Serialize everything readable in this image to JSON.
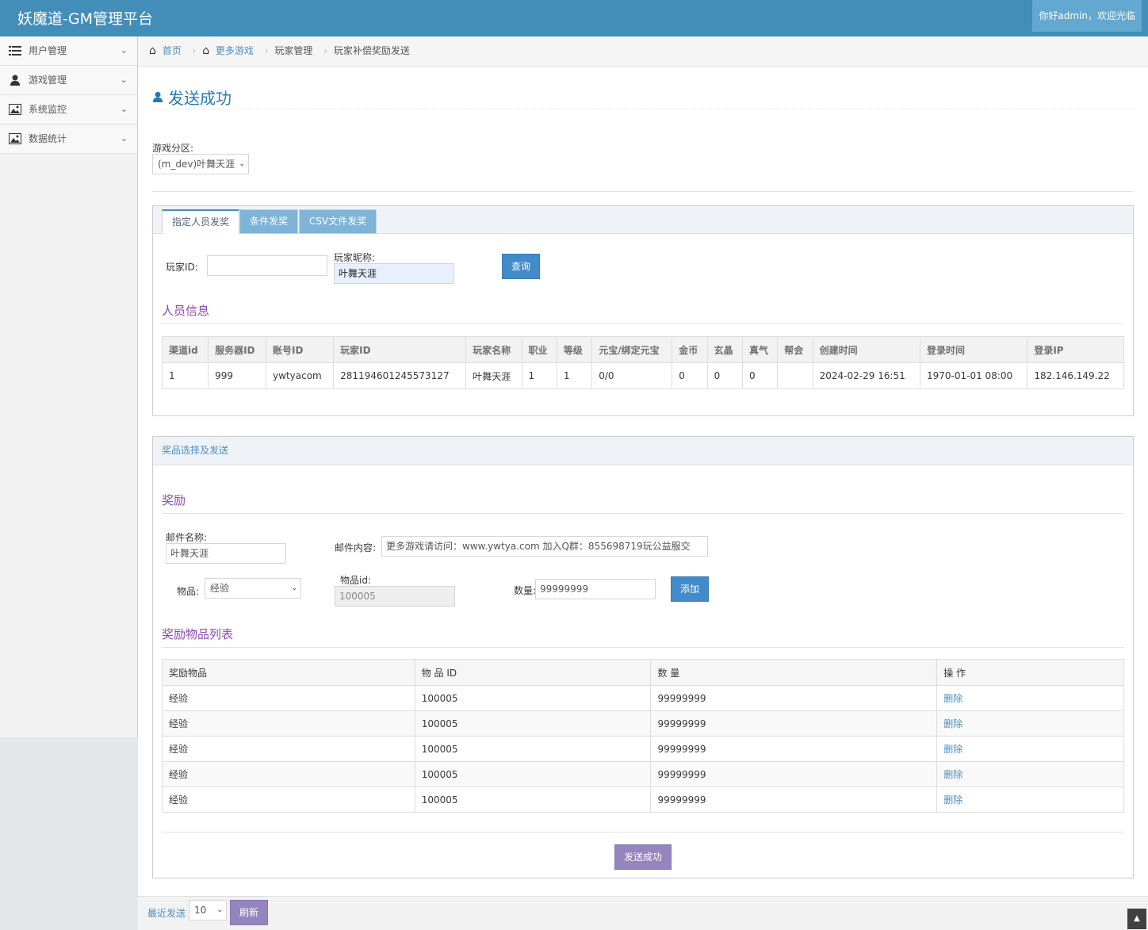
{
  "header": {
    "brand": "妖魔道-GM管理平台",
    "greeting": "你好admin，欢迎光临"
  },
  "sidebar": {
    "items": [
      {
        "label": "用户管理",
        "icon": "list-icon"
      },
      {
        "label": "游戏管理",
        "icon": "user-icon"
      },
      {
        "label": "系统监控",
        "icon": "picture-icon"
      },
      {
        "label": "数据统计",
        "icon": "picture-icon"
      }
    ]
  },
  "breadcrumb": {
    "home": "首页",
    "more_games": "更多游戏",
    "player_mgmt": "玩家管理",
    "current": "玩家补偿奖励发送"
  },
  "page": {
    "title": "发送成功"
  },
  "zone": {
    "label": "游戏分区:",
    "selected": "(m_dev)叶舞天涯"
  },
  "tabs": [
    "指定人员发奖",
    "条件发奖",
    "CSV文件发奖"
  ],
  "search": {
    "player_id_label": "玩家ID:",
    "player_id_value": "",
    "nickname_label": "玩家昵称:",
    "nickname_value": "叶舞天涯",
    "query_button": "查询"
  },
  "player_info": {
    "title": "人员信息",
    "columns": [
      "渠道id",
      "服务器ID",
      "账号ID",
      "玩家ID",
      "玩家名称",
      "职业",
      "等级",
      "元宝/绑定元宝",
      "金币",
      "玄晶",
      "真气",
      "帮会",
      "创建时间",
      "登录时间",
      "登录IP"
    ],
    "rows": [
      [
        "1",
        "999",
        "ywtyacom",
        "281194601245573127",
        "叶舞天涯",
        "1",
        "1",
        "0/0",
        "0",
        "0",
        "0",
        "",
        "2024-02-29 16:51",
        "1970-01-01 08:00",
        "182.146.149.22"
      ]
    ]
  },
  "reward_panel": {
    "header": "奖品选择及发送",
    "section_title": "奖励"
  },
  "mail": {
    "name_label": "邮件名称:",
    "name_value": "叶舞天涯",
    "content_label": "邮件内容:",
    "content_value": "更多游戏请访问：www.ywtya.com  加入Q群：855698719玩公益服交"
  },
  "item": {
    "label": "物品:",
    "selected": "经验",
    "id_label": "物品id:",
    "id_value": "100005",
    "qty_label": "数量:",
    "qty_value": "99999999",
    "add_button": "添加"
  },
  "reward_list": {
    "title": "奖励物品列表",
    "columns": [
      "奖励物品",
      "物 品 ID",
      "数 量",
      "操 作"
    ],
    "rows": [
      [
        "经验",
        "100005",
        "99999999",
        "删除"
      ],
      [
        "经验",
        "100005",
        "99999999",
        "删除"
      ],
      [
        "经验",
        "100005",
        "99999999",
        "删除"
      ],
      [
        "经验",
        "100005",
        "99999999",
        "删除"
      ],
      [
        "经验",
        "100005",
        "99999999",
        "删除"
      ]
    ]
  },
  "send_button": "发送成功",
  "footer": {
    "recent_label": "最近发送",
    "count_selected": "10",
    "refresh_button": "刷新"
  }
}
